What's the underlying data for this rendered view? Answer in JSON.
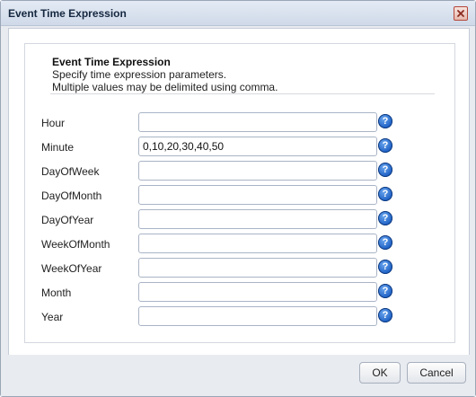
{
  "window": {
    "title": "Event Time Expression"
  },
  "header": {
    "title": "Event Time Expression",
    "line1": "Specify time expression parameters.",
    "line2": "Multiple values may be delimited using comma."
  },
  "fields": [
    {
      "label": "Hour",
      "value": ""
    },
    {
      "label": "Minute",
      "value": "0,10,20,30,40,50"
    },
    {
      "label": "DayOfWeek",
      "value": ""
    },
    {
      "label": "DayOfMonth",
      "value": ""
    },
    {
      "label": "DayOfYear",
      "value": ""
    },
    {
      "label": "WeekOfMonth",
      "value": ""
    },
    {
      "label": "WeekOfYear",
      "value": ""
    },
    {
      "label": "Month",
      "value": ""
    },
    {
      "label": "Year",
      "value": ""
    }
  ],
  "help_glyph": "?",
  "buttons": {
    "ok": "OK",
    "cancel": "Cancel"
  },
  "icons": {
    "close": "close-icon",
    "help": "help-icon"
  }
}
